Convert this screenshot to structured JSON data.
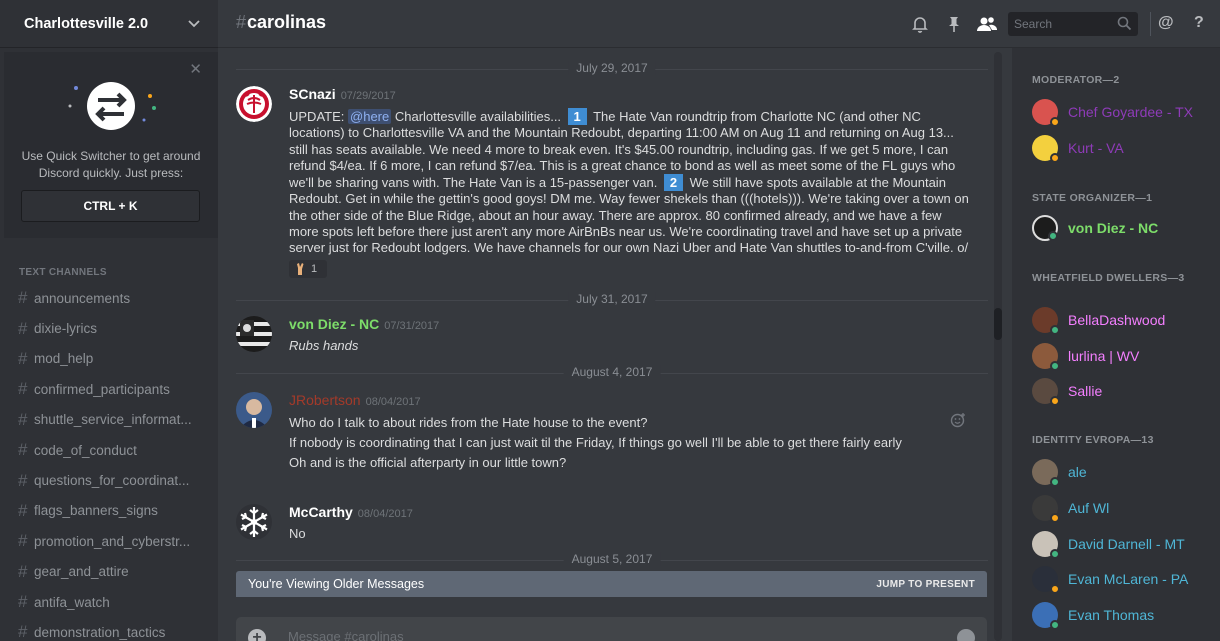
{
  "server": {
    "name": "Charlottesville 2.0"
  },
  "quick_switcher": {
    "text": "Use Quick Switcher to get around Discord quickly. Just press:",
    "key": "CTRL + K"
  },
  "sidebar": {
    "category": "TEXT CHANNELS",
    "channels": [
      "announcements",
      "dixie-lyrics",
      "mod_help",
      "confirmed_participants",
      "shuttle_service_informat...",
      "code_of_conduct",
      "questions_for_coordinat...",
      "flags_banners_signs",
      "promotion_and_cyberstr...",
      "gear_and_attire",
      "antifa_watch",
      "demonstration_tactics"
    ]
  },
  "topbar": {
    "channel": "carolinas",
    "search_placeholder": "Search"
  },
  "messages": {
    "dividers": [
      "July 29, 2017",
      "July 31, 2017",
      "August 4, 2017",
      "August 5, 2017"
    ],
    "m1": {
      "author": "SCnazi",
      "time": "07/29/2017",
      "author_color": "#ffffff",
      "p1": "UPDATE:",
      "mention": "@here",
      "p2": "Charlottesville availabilities...",
      "n1": "1",
      "p3": "The Hate Van roundtrip from Charlotte NC (and other NC locations) to Charlottesville VA and the Mountain Redoubt, departing 11:00 AM on Aug 11 and returning on Aug 13... still has seats available. We need 4 more to break even. It's $45.00 roundtrip, including gas. If we get 5 more, I can refund $4/ea. If 6 more, I can refund $7/ea. This is a great chance to bond as well as meet some of the FL guys who we'll be sharing vans with. The Hate Van is a 15-passenger van.",
      "n2": "2",
      "p4": "We still have spots available at the Mountain Redoubt. Get in while the gettin's good goys! DM me. Way fewer shekels than (((hotels))). We're taking over a town on the other side of the Blue Ridge, about an hour away. There are approx. 80 confirmed already, and we have a few more spots left before there just aren't any more AirBnBs near us. We're coordinating travel and have set up a private server just for Redoubt lodgers. We have channels for our own Nazi Uber and Hate Van shuttles to-and-from C'ville. o/",
      "reaction_count": "1"
    },
    "m2": {
      "author": "von Diez - NC",
      "time": "07/31/2017",
      "text": "Rubs hands",
      "author_color": "#7ddd6a"
    },
    "m3": {
      "author": "JRobertson",
      "time": "08/04/2017",
      "author_color": "#a33a2a",
      "lines": [
        "Who do I talk to about rides from the Hate house to the event?",
        "If nobody is coordinating that I can just wait til the Friday, If things go well I'll be able to get there fairly early",
        "Oh and is the official afterparty in our little town?"
      ]
    },
    "m4": {
      "author": "McCarthy",
      "time": "08/04/2017",
      "text": "No",
      "author_color": "#ffffff"
    }
  },
  "older_bar": {
    "label": "You're Viewing Older Messages",
    "jump": "JUMP TO PRESENT"
  },
  "composer": {
    "placeholder": "Message #carolinas"
  },
  "members": {
    "roles": [
      {
        "title": "MODERATOR—2"
      },
      {
        "title": "STATE ORGANIZER—1"
      },
      {
        "title": "WHEATFIELD DWELLERS—3"
      },
      {
        "title": "IDENTITY EVROPA—13"
      }
    ],
    "list": [
      {
        "name": "Chef Goyardee - TX",
        "color": "#8e3bb8",
        "status": "#faa61a"
      },
      {
        "name": "Kurt - VA",
        "color": "#8e3bb8",
        "status": "#faa61a"
      },
      {
        "name": "von Diez - NC",
        "color": "#7ddd6a",
        "status": "#43b581"
      },
      {
        "name": "BellaDashwood",
        "color": "#f47fff",
        "status": "#43b581"
      },
      {
        "name": "lurlina | WV",
        "color": "#f47fff",
        "status": "#43b581"
      },
      {
        "name": "Sallie",
        "color": "#f47fff",
        "status": "#faa61a"
      },
      {
        "name": "ale",
        "color": "#4fb6d6",
        "status": "#43b581"
      },
      {
        "name": "Auf Wl",
        "color": "#4fb6d6",
        "status": "#faa61a"
      },
      {
        "name": "David Darnell - MT",
        "color": "#4fb6d6",
        "status": "#43b581"
      },
      {
        "name": "Evan McLaren - PA",
        "color": "#4fb6d6",
        "status": "#faa61a"
      },
      {
        "name": "Evan Thomas",
        "color": "#4fb6d6",
        "status": "#43b581"
      }
    ]
  }
}
